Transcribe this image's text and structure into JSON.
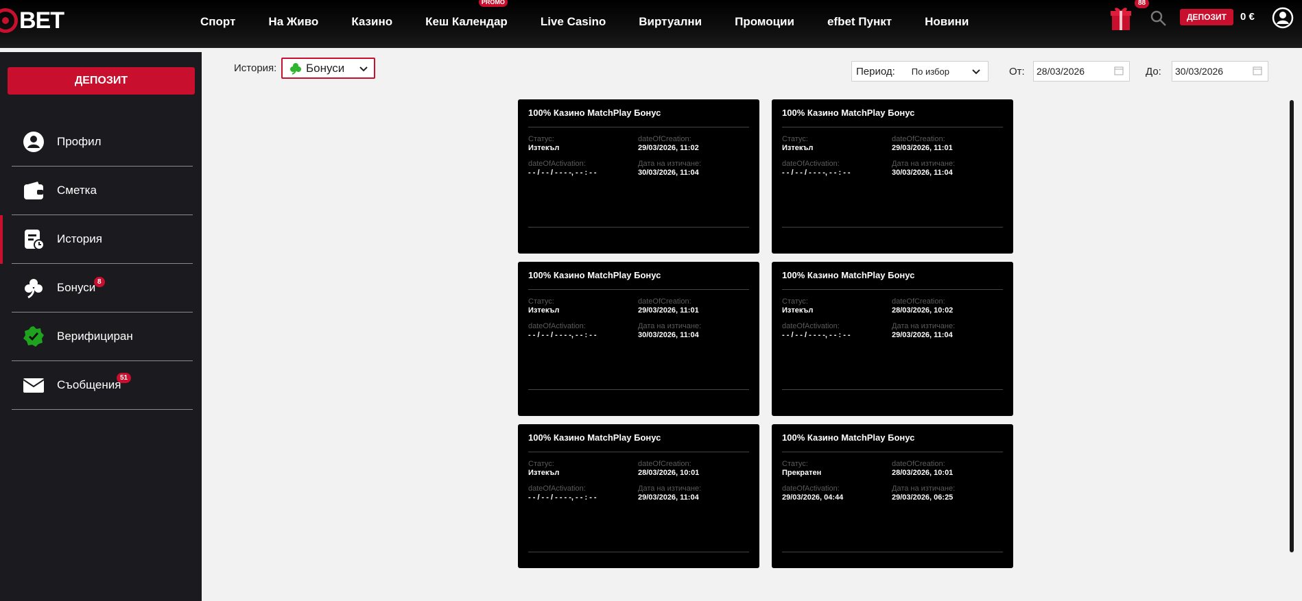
{
  "header": {
    "logo_text": "BET",
    "nav": [
      {
        "label": "Спорт"
      },
      {
        "label": "На Живо"
      },
      {
        "label": "Казино"
      },
      {
        "label": "Кеш Календар",
        "badge": "PROMO"
      },
      {
        "label": "Live Casino"
      },
      {
        "label": "Виртуални"
      },
      {
        "label": "Промоции"
      },
      {
        "label": "efbet Пункт"
      },
      {
        "label": "Новини"
      }
    ],
    "gift_badge": "88",
    "deposit_label": "ДЕПОЗИТ",
    "balance": "0 €"
  },
  "sidebar": {
    "deposit_label": "ДЕПОЗИТ",
    "items": [
      {
        "label": "Профил",
        "icon": "profile-icon"
      },
      {
        "label": "Сметка",
        "icon": "wallet-icon"
      },
      {
        "label": "История",
        "icon": "history-icon",
        "active": true
      },
      {
        "label": "Бонуси",
        "icon": "clover-icon",
        "badge": "8"
      },
      {
        "label": "Верифициран",
        "icon": "verified-icon"
      },
      {
        "label": "Съобщения",
        "icon": "envelope-icon",
        "badge": "51"
      }
    ]
  },
  "filters": {
    "history_label": "История:",
    "history_value": "Бонуси",
    "period_label": "Период:",
    "period_value": "По избор",
    "from_label": "От:",
    "from_value": "28/03/2026",
    "to_label": "До:",
    "to_value": "30/03/2026"
  },
  "colors": {
    "accent": "#c8102e",
    "card_bg": "#000000",
    "clover": "#2db52d",
    "verified": "#1fa31f"
  },
  "cards": [
    {
      "title": "100% Казино MatchPlay Бонус",
      "status_label": "Статус:",
      "status": "Изтекъл",
      "created_label": "dateOfCreation:",
      "created": "29/03/2026, 11:02",
      "activation_label": "dateOfActivation:",
      "activation": "- - / - - / - - - -, - - : - -",
      "expiry_label": "Дата на изтичане:",
      "expiry": "30/03/2026, 11:04"
    },
    {
      "title": "100% Казино MatchPlay Бонус",
      "status_label": "Статус:",
      "status": "Изтекъл",
      "created_label": "dateOfCreation:",
      "created": "29/03/2026, 11:01",
      "activation_label": "dateOfActivation:",
      "activation": "- - / - - / - - - -, - - : - -",
      "expiry_label": "Дата на изтичане:",
      "expiry": "30/03/2026, 11:04"
    },
    {
      "title": "100% Казино MatchPlay Бонус",
      "status_label": "Статус:",
      "status": "Изтекъл",
      "created_label": "dateOfCreation:",
      "created": "29/03/2026, 11:01",
      "activation_label": "dateOfActivation:",
      "activation": "- - / - - / - - - -, - - : - -",
      "expiry_label": "Дата на изтичане:",
      "expiry": "30/03/2026, 11:04"
    },
    {
      "title": "100% Казино MatchPlay Бонус",
      "status_label": "Статус:",
      "status": "Изтекъл",
      "created_label": "dateOfCreation:",
      "created": "28/03/2026, 10:02",
      "activation_label": "dateOfActivation:",
      "activation": "- - / - - / - - - -, - - : - -",
      "expiry_label": "Дата на изтичане:",
      "expiry": "29/03/2026, 11:04"
    },
    {
      "title": "100% Казино MatchPlay Бонус",
      "status_label": "Статус:",
      "status": "Изтекъл",
      "created_label": "dateOfCreation:",
      "created": "28/03/2026, 10:01",
      "activation_label": "dateOfActivation:",
      "activation": "- - / - - / - - - -, - - : - -",
      "expiry_label": "Дата на изтичане:",
      "expiry": "29/03/2026, 11:04"
    },
    {
      "title": "100% Казино MatchPlay Бонус",
      "status_label": "Статус:",
      "status": "Прекратен",
      "created_label": "dateOfCreation:",
      "created": "28/03/2026, 10:01",
      "activation_label": "dateOfActivation:",
      "activation": "29/03/2026, 04:44",
      "expiry_label": "Дата на изтичане:",
      "expiry": "29/03/2026, 06:25"
    }
  ]
}
